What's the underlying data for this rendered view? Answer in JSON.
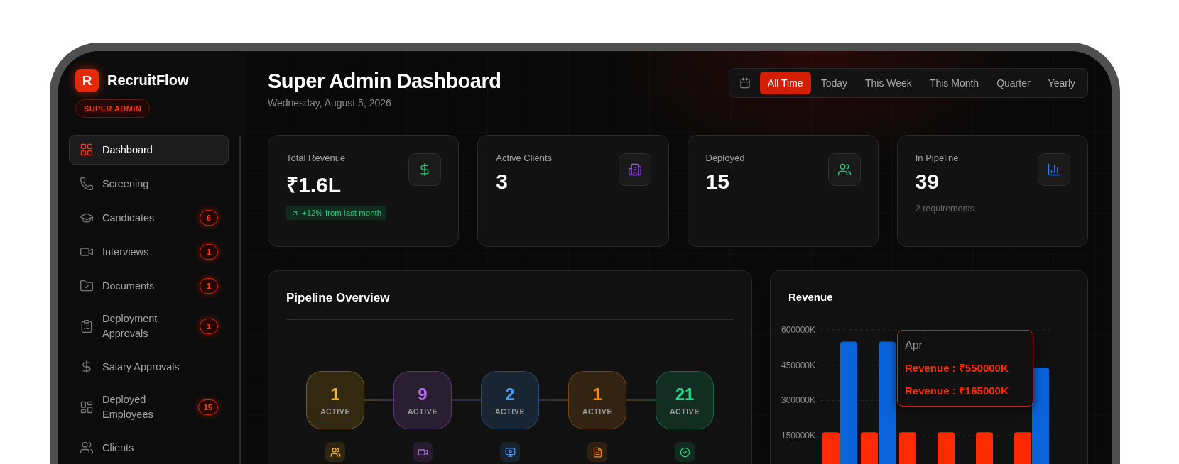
{
  "sidebar": {
    "logo_letter": "R",
    "brand": "RecruitFlow",
    "role_badge": "SUPER ADMIN",
    "items": [
      {
        "label": "Dashboard",
        "selected": true
      },
      {
        "label": "Screening",
        "selected": false
      },
      {
        "label": "Candidates",
        "badge": "6",
        "selected": false
      },
      {
        "label": "Interviews",
        "badge": "1",
        "selected": false
      },
      {
        "label": "Documents",
        "badge": "1",
        "selected": false
      },
      {
        "label": "Deployment Approvals",
        "badge": "1",
        "selected": false
      },
      {
        "label": "Salary Approvals",
        "selected": false
      },
      {
        "label": "Deployed Employees",
        "badge": "15",
        "selected": false
      },
      {
        "label": "Clients",
        "selected": false
      }
    ]
  },
  "header": {
    "title": "Super Admin Dashboard",
    "date": "Wednesday, August 5, 2026",
    "filters": [
      {
        "label": "All Time",
        "selected": true
      },
      {
        "label": "Today",
        "selected": false
      },
      {
        "label": "This Week",
        "selected": false
      },
      {
        "label": "This Month",
        "selected": false
      },
      {
        "label": "Quarter",
        "selected": false
      },
      {
        "label": "Yearly",
        "selected": false
      }
    ]
  },
  "stats": [
    {
      "label": "Total Revenue",
      "value": "₹1.6L",
      "trend": "+12% from last month"
    },
    {
      "label": "Active Clients",
      "value": "3"
    },
    {
      "label": "Deployed",
      "value": "15"
    },
    {
      "label": "In Pipeline",
      "value": "39",
      "note": "2 requirements"
    }
  ],
  "pipeline": {
    "title": "Pipeline Overview",
    "stages": [
      {
        "count": "1",
        "label": "ACTIVE",
        "color": "#f5b71a"
      },
      {
        "count": "9",
        "label": "ACTIVE",
        "color": "#b46cf0"
      },
      {
        "count": "2",
        "label": "ACTIVE",
        "color": "#4b9bf5"
      },
      {
        "count": "1",
        "label": "ACTIVE",
        "color": "#f58a1a"
      },
      {
        "count": "21",
        "label": "ACTIVE",
        "color": "#1ed98a"
      }
    ]
  },
  "revenue": {
    "title": "Revenue",
    "chart_data": {
      "type": "bar",
      "ylim": [
        0,
        600000
      ],
      "yticks": [
        {
          "value": 150000,
          "label": "150000K"
        },
        {
          "value": 300000,
          "label": "300000K"
        },
        {
          "value": 450000,
          "label": "450000K"
        },
        {
          "value": 600000,
          "label": "600000K"
        }
      ],
      "series": [
        {
          "color": "#ff2a00",
          "values": [
            165000,
            165000,
            165000,
            165000,
            165000,
            165000
          ]
        },
        {
          "color": "#0a63d8",
          "values": [
            550000,
            550000,
            null,
            null,
            null,
            440000
          ]
        }
      ],
      "grid": true
    },
    "tooltip": {
      "title": "Apr",
      "lines": [
        "Revenue : ₹550000K",
        "Revenue : ₹165000K"
      ]
    }
  }
}
